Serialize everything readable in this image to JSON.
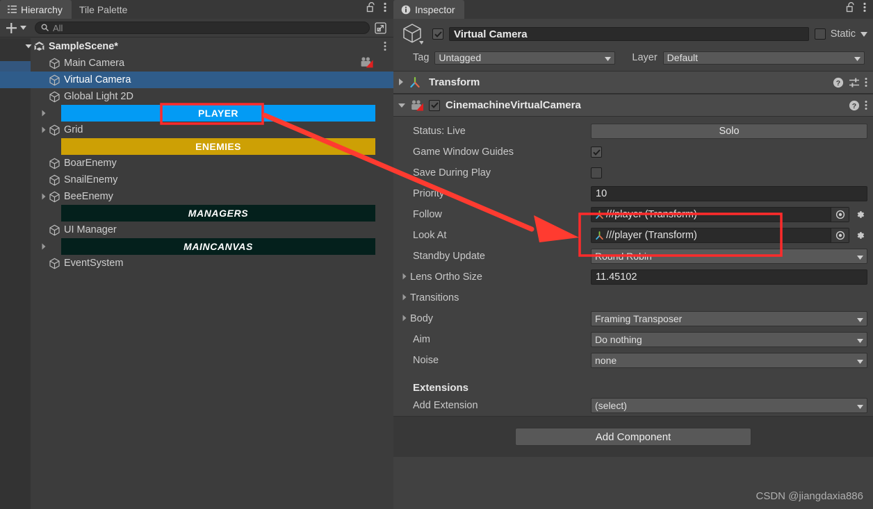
{
  "hierarchy": {
    "tabs": [
      {
        "label": "Hierarchy",
        "icon": "hierarchy-icon",
        "active": true
      },
      {
        "label": "Tile Palette",
        "icon": "",
        "active": false
      }
    ],
    "window_icons": [
      "lock-open-icon",
      "kebab-menu-icon"
    ],
    "toolbar": {
      "add_label": "+",
      "add_dropdown_icon": "chevron-down-icon",
      "search_icon": "search-icon",
      "search_value": "",
      "search_placeholder": "All",
      "detach_icon": "detach-window-icon"
    },
    "items": [
      {
        "label": "SampleScene*",
        "depth": 0,
        "icon": "unity-scene-icon",
        "foldout": "open",
        "kind": "scene",
        "kebab": true
      },
      {
        "label": "Main Camera",
        "depth": 1,
        "icon": "gameobject-cube-icon",
        "foldout": "none",
        "kind": "object",
        "right_icon": "cinemachine-brain-icon"
      },
      {
        "label": "Virtual Camera",
        "depth": 1,
        "icon": "gameobject-cube-icon",
        "foldout": "none",
        "kind": "object",
        "selected": true
      },
      {
        "label": "Global Light 2D",
        "depth": 1,
        "icon": "gameobject-cube-icon",
        "foldout": "none",
        "kind": "object"
      },
      {
        "label": "PLAYER",
        "depth": 1,
        "icon": "",
        "foldout": "closed",
        "kind": "banner",
        "band_color": "#039BF4",
        "band_text_color": "#ffffff",
        "italic": false
      },
      {
        "label": "Grid",
        "depth": 1,
        "icon": "gameobject-cube-icon",
        "foldout": "closed",
        "kind": "object"
      },
      {
        "label": "ENEMIES",
        "depth": 1,
        "icon": "",
        "foldout": "none",
        "kind": "banner",
        "band_color": "#CDA005",
        "band_text_color": "#ffffff",
        "italic": false
      },
      {
        "label": "BoarEnemy",
        "depth": 1,
        "icon": "gameobject-cube-icon",
        "foldout": "none",
        "kind": "object"
      },
      {
        "label": "SnailEnemy",
        "depth": 1,
        "icon": "gameobject-cube-icon",
        "foldout": "none",
        "kind": "object"
      },
      {
        "label": "BeeEnemy",
        "depth": 1,
        "icon": "gameobject-cube-icon",
        "foldout": "closed",
        "kind": "object"
      },
      {
        "label": "MANAGERS",
        "depth": 1,
        "icon": "",
        "foldout": "none",
        "kind": "banner",
        "band_color": "#04201C",
        "band_text_color": "#ffffff",
        "italic": true
      },
      {
        "label": "UI Manager",
        "depth": 1,
        "icon": "gameobject-cube-icon",
        "foldout": "none",
        "kind": "object"
      },
      {
        "label": "MAINCANVAS",
        "depth": 1,
        "icon": "",
        "foldout": "closed",
        "kind": "banner",
        "band_color": "#04201C",
        "band_text_color": "#ffffff",
        "italic": true
      },
      {
        "label": "EventSystem",
        "depth": 1,
        "icon": "gameobject-cube-icon",
        "foldout": "none",
        "kind": "object"
      }
    ]
  },
  "inspector": {
    "tabs": [
      {
        "label": "Inspector",
        "icon": "info-circle-icon",
        "active": true
      }
    ],
    "window_icons": [
      "lock-open-icon",
      "kebab-menu-icon"
    ],
    "object_header": {
      "icon": "gameobject-cube-icon",
      "enabled": true,
      "name": "Virtual Camera",
      "static_label": "Static",
      "static_checked": false,
      "static_dropdown_icon": "chevron-down-icon",
      "tag_label": "Tag",
      "tag_value": "Untagged",
      "layer_label": "Layer",
      "layer_value": "Default"
    },
    "components": [
      {
        "name": "Transform",
        "icon": "transform-axis-icon",
        "foldout": "closed",
        "has_checkbox": false,
        "header_icons": [
          "help-icon",
          "preset-icon",
          "kebab-menu-icon"
        ]
      },
      {
        "name": "CinemachineVirtualCamera",
        "icon": "cinemachine-icon",
        "foldout": "open",
        "has_checkbox": true,
        "enabled": true,
        "header_icons": [
          "help-icon",
          "kebab-menu-icon"
        ]
      }
    ],
    "vcam_properties": [
      {
        "label": "Status: Live",
        "type": "button",
        "value": "Solo",
        "foldout": "none"
      },
      {
        "label": "Game Window Guides",
        "type": "checkbox",
        "value": true,
        "foldout": "none"
      },
      {
        "label": "Save During Play",
        "type": "checkbox",
        "value": false,
        "foldout": "none"
      },
      {
        "label": "Priority",
        "type": "text",
        "value": "10",
        "foldout": "none"
      },
      {
        "label": "Follow",
        "type": "object",
        "value": "///player (Transform)",
        "foldout": "none",
        "icon": "transform-axis-icon",
        "picker": "object-picker-icon",
        "gear": "gear-icon",
        "highlighted": true
      },
      {
        "label": "Look At",
        "type": "object",
        "value": "///player (Transform)",
        "foldout": "none",
        "icon": "transform-axis-icon",
        "picker": "object-picker-icon",
        "gear": "gear-icon",
        "highlighted": true
      },
      {
        "label": "Standby Update",
        "type": "dropdown",
        "value": "Round Robin",
        "foldout": "none"
      },
      {
        "label": "Lens Ortho Size",
        "type": "text",
        "value": "11.45102",
        "foldout": "closed"
      },
      {
        "label": "Transitions",
        "type": "none",
        "value": "",
        "foldout": "closed"
      },
      {
        "label": "Body",
        "type": "dropdown",
        "value": "Framing Transposer",
        "foldout": "closed"
      },
      {
        "label": "Aim",
        "type": "dropdown",
        "value": "Do nothing",
        "foldout": "none"
      },
      {
        "label": "Noise",
        "type": "dropdown",
        "value": "none",
        "foldout": "none"
      }
    ],
    "extensions": {
      "section_title": "Extensions",
      "add_extension_label": "Add Extension",
      "add_extension_value": "(select)"
    },
    "add_component_label": "Add Component"
  },
  "annotations": {
    "highlight_color": "#FF2B2B",
    "arrow": "red-arrow-pointing-to-follow-field"
  },
  "watermark": "CSDN @jiangdaxia886"
}
